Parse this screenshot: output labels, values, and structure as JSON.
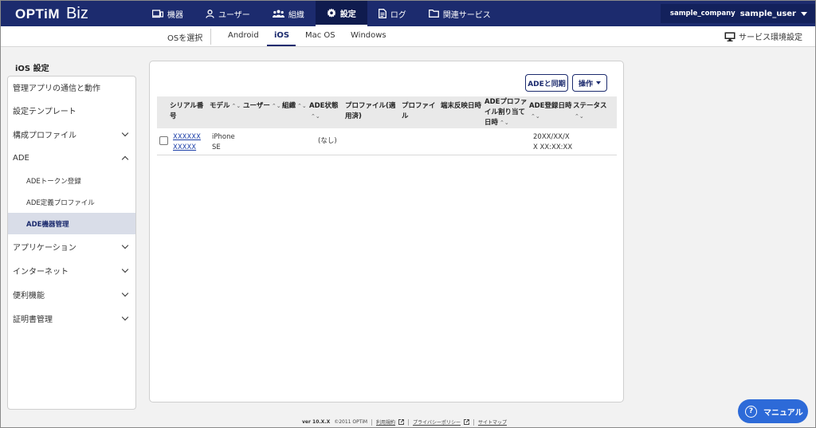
{
  "header": {
    "logo": "OPTiM",
    "logo_sub": "Biz",
    "nav": [
      {
        "label": "機器",
        "icon": "devices-icon"
      },
      {
        "label": "ユーザー",
        "icon": "user-icon"
      },
      {
        "label": "組織",
        "icon": "group-icon"
      },
      {
        "label": "設定",
        "icon": "gear-icon"
      },
      {
        "label": "ログ",
        "icon": "log-icon"
      },
      {
        "label": "関連サービス",
        "icon": "folder-icon"
      }
    ],
    "active_nav": "設定",
    "company": "sample_company",
    "user": "sample_user"
  },
  "subnav": {
    "select_os": "OSを選択",
    "tabs": [
      "Android",
      "iOS",
      "Mac OS",
      "Windows"
    ],
    "active_tab": "iOS",
    "service_env": "サービス環境設定"
  },
  "sidebar": {
    "title": "iOS 設定",
    "items": [
      {
        "label": "管理アプリの通信と動作"
      },
      {
        "label": "設定テンプレート"
      },
      {
        "label": "構成プロファイル",
        "expandable": true,
        "expanded": false
      },
      {
        "label": "ADE",
        "expandable": true,
        "expanded": true
      },
      {
        "label": "ADEトークン登録"
      },
      {
        "label": "ADE定義プロファイル"
      },
      {
        "label": "ADE機器管理",
        "active": true
      },
      {
        "label": "アプリケーション",
        "expandable": true,
        "expanded": false
      },
      {
        "label": "インターネット",
        "expandable": true,
        "expanded": false
      },
      {
        "label": "便利機能",
        "expandable": true,
        "expanded": false
      },
      {
        "label": "証明書管理",
        "expandable": true,
        "expanded": false
      }
    ]
  },
  "main": {
    "sync_button": "ADEと同期",
    "ops_button": "操作",
    "columns": [
      {
        "l1": "シリアル番",
        "l2": "号",
        "sortable": true
      },
      {
        "l1": "モデル",
        "l2": "",
        "sortable": true
      },
      {
        "l1": "ユーザー",
        "l2": "",
        "sortable": true
      },
      {
        "l1": "組織",
        "l2": "",
        "sortable": true
      },
      {
        "l1": "ADE状態",
        "l2": "",
        "sortable": true
      },
      {
        "l1": "プロファイル(適",
        "l2": "用済)",
        "sortable": false
      },
      {
        "l1": "プロファイ",
        "l2": "ル",
        "sortable": false
      },
      {
        "l1": "端末反映日時",
        "l2": "",
        "sortable": false
      },
      {
        "l1": "ADEプロファ",
        "l2": "イル割り当て",
        "l3": "日時",
        "sortable": true
      },
      {
        "l1": "ADE登録日時",
        "l2": "",
        "sortable": true
      },
      {
        "l1": "ステータス",
        "l2": "",
        "sortable": true
      }
    ],
    "rows": [
      {
        "serial_1": "XXXXXX",
        "serial_2": "XXXXX",
        "model_1": "iPhone",
        "model_2": "SE",
        "ade_state": "(なし)",
        "registered_1": "20XX/XX/X",
        "registered_2": "X XX:XX:XX"
      }
    ]
  },
  "footer": {
    "version": "ver 10.X.X",
    "copyright": "©2011 OPTiM",
    "links": [
      "利用規約",
      "プライバシーポリシー",
      "サイトマップ"
    ]
  },
  "manual_button": "マニュアル",
  "colors": {
    "primary": "#1c2b6e",
    "accent": "#2d6ad8"
  }
}
